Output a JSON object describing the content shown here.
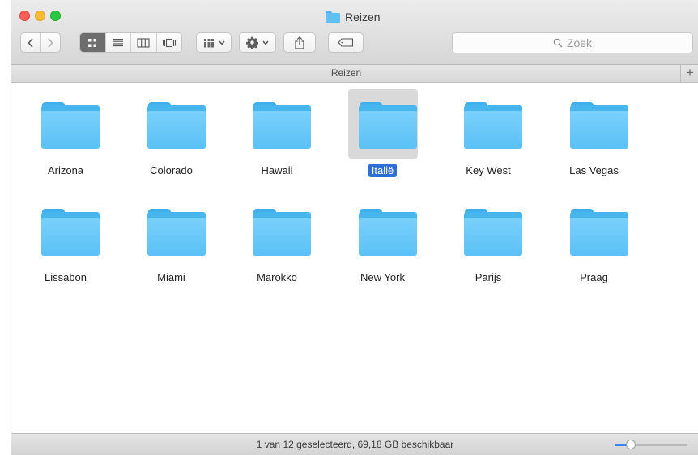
{
  "window": {
    "title": "Reizen",
    "controls": [
      "close",
      "minimize",
      "zoom"
    ]
  },
  "toolbar": {
    "back_icon": "chevron-left-icon",
    "forward_icon": "chevron-right-icon",
    "view_modes": [
      {
        "name": "icon-view",
        "icon": "grid-icon",
        "active": true
      },
      {
        "name": "list-view",
        "icon": "list-icon",
        "active": false
      },
      {
        "name": "column-view",
        "icon": "columns-icon",
        "active": false
      },
      {
        "name": "cover-flow-view",
        "icon": "coverflow-icon",
        "active": false
      }
    ],
    "arrange_icon": "arrange-icon",
    "action_icon": "gear-icon",
    "share_icon": "share-icon",
    "tag_icon": "tag-icon",
    "search_placeholder": "Zoek"
  },
  "pathbar": {
    "label": "Reizen",
    "add_tab_glyph": "+"
  },
  "items": [
    {
      "name": "Arizona",
      "selected": false
    },
    {
      "name": "Colorado",
      "selected": false
    },
    {
      "name": "Hawaii",
      "selected": false
    },
    {
      "name": "Italië",
      "selected": true
    },
    {
      "name": "Key West",
      "selected": false
    },
    {
      "name": "Las Vegas",
      "selected": false
    },
    {
      "name": "Lissabon",
      "selected": false
    },
    {
      "name": "Miami",
      "selected": false
    },
    {
      "name": "Marokko",
      "selected": false
    },
    {
      "name": "New York",
      "selected": false
    },
    {
      "name": "Parijs",
      "selected": false
    },
    {
      "name": "Praag",
      "selected": false
    }
  ],
  "status": {
    "text": "1 van 12 geselecteerd, 69,18 GB beschikbaar",
    "icon_size_level": 0.22
  },
  "colors": {
    "folder": "#5bc1f6",
    "selection": "#2f6ed9",
    "slider_accent": "#3a82f7"
  }
}
